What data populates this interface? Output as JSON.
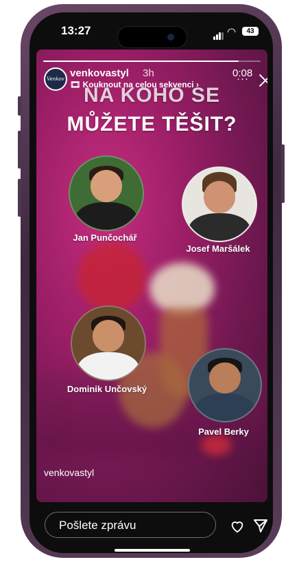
{
  "status_bar": {
    "time": "13:27",
    "battery": "43"
  },
  "story": {
    "username": "venkovastyl",
    "posted_ago": "3h",
    "sequence_link": "🎞 Kouknout na celou sekvenci ›",
    "timer": "0:08",
    "more_icon": "more-horizontal-icon",
    "close_icon": "close-icon",
    "progress": 0.9,
    "title_line1": "NA KOHO SE",
    "title_line2": "MŮŽETE TĚŠIT?",
    "chefs": [
      {
        "name": "Jan Punčochář"
      },
      {
        "name": "Josef Maršálek"
      },
      {
        "name": "Dominik Unčovský"
      },
      {
        "name": "Pavel Berky"
      }
    ],
    "caption": "venkovastyl"
  },
  "reply": {
    "placeholder": "Pošlete zprávu",
    "like_icon": "heart-icon",
    "send_icon": "send-icon"
  },
  "colors": {
    "story_bg": "#9b1e66",
    "text": "#ffffff"
  }
}
